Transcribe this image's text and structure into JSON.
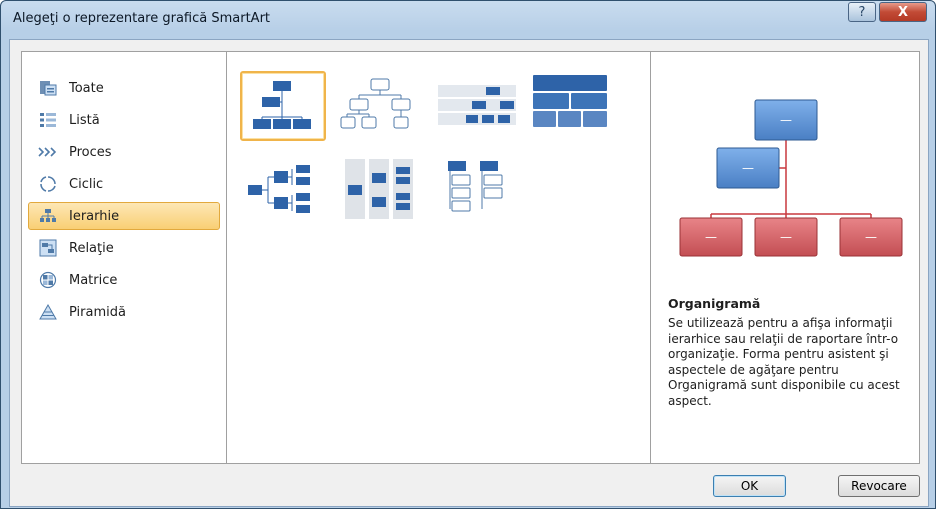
{
  "window": {
    "title": "Alegeţi o reprezentare grafică SmartArt",
    "help_glyph": "?",
    "close_glyph": "X"
  },
  "categories": [
    {
      "label": "Toate",
      "icon": "all-icon",
      "selected": false
    },
    {
      "label": "Listă",
      "icon": "list-icon",
      "selected": false
    },
    {
      "label": "Proces",
      "icon": "process-icon",
      "selected": false
    },
    {
      "label": "Ciclic",
      "icon": "cycle-icon",
      "selected": false
    },
    {
      "label": "Ierarhie",
      "icon": "hierarchy-icon",
      "selected": true
    },
    {
      "label": "Relaţie",
      "icon": "relationship-icon",
      "selected": false
    },
    {
      "label": "Matrice",
      "icon": "matrix-icon",
      "selected": false
    },
    {
      "label": "Piramidă",
      "icon": "pyramid-icon",
      "selected": false
    }
  ],
  "layouts": [
    {
      "kind": "org-chart",
      "selected": true
    },
    {
      "kind": "hierarchy-outline"
    },
    {
      "kind": "labeled-hierarchy"
    },
    {
      "kind": "table-hierarchy"
    },
    {
      "kind": "horizontal-hierarchy"
    },
    {
      "kind": "horizontal-labeled-hierarchy"
    },
    {
      "kind": "hierarchy-list"
    }
  ],
  "preview": {
    "shape_label": "—"
  },
  "description": {
    "title": "Organigramă",
    "text": "Se utilizează pentru a afişa informaţii ierarhice sau relaţii de raportare într-o organizaţie. Forma pentru asistent şi aspectele de agăţare pentru Organigramă sunt disponibile cu acest aspect."
  },
  "buttons": {
    "ok": "OK",
    "cancel": "Revocare"
  },
  "colors": {
    "blue_shape": "#5a8ed0",
    "red_shape": "#d0565a",
    "connector": "#c9393f",
    "selection": "#f9cf74"
  }
}
